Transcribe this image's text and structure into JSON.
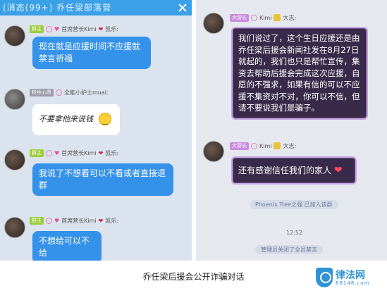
{
  "left": {
    "header_text": "(消态(99+) 乔任梁部落营",
    "messages": [
      {
        "tag": "群主",
        "name": "首席营长Kimi",
        "suffix": "凯乐:",
        "text": "现在就是应援时间不应援就禁言祈福"
      },
      {
        "tag": "粉丝心愿",
        "name": "全能小护士muai:",
        "suffix": "",
        "text": "不要拿他来说钱"
      },
      {
        "tag": "群主",
        "name": "首席营长Kimi",
        "suffix": "凯乐:",
        "text": "我说了不想看可以不看或者直接退群"
      },
      {
        "tag": "群主",
        "name": "首席营长Kimi",
        "suffix": "凯乐:",
        "text": "不想给可以不给"
      }
    ]
  },
  "right": {
    "messages": [
      {
        "tag": "大营长",
        "name": "Kimi",
        "suffix": "大志:",
        "text": "我们说过了，这个生日应援还是由乔任梁后援会新闻社发在8月27日就起的，我们也只是帮忙宣传，集资去帮助后援会完成这次应援，自愿的不强求，如果有信的可以不应援不集资对不对，你可以不信，但请不要说我们是骗子。"
      },
      {
        "tag": "大营长",
        "name": "Kimi",
        "suffix": "大志:",
        "text": "还有感谢信任我们的家人"
      }
    ],
    "system_join": "Phoenix Tree之强 已加入该群",
    "time": "12:52",
    "system_bottom": "管理员关闭了全员禁言"
  },
  "caption": "乔任梁后援会公开诈骗对话",
  "watermark": {
    "title": "律法网",
    "subtitle": "88148.com"
  },
  "colors": {
    "blue_bubble": "#3592ea",
    "purple_bubble": "#3a2a4a",
    "header": "#3aa0e8"
  }
}
